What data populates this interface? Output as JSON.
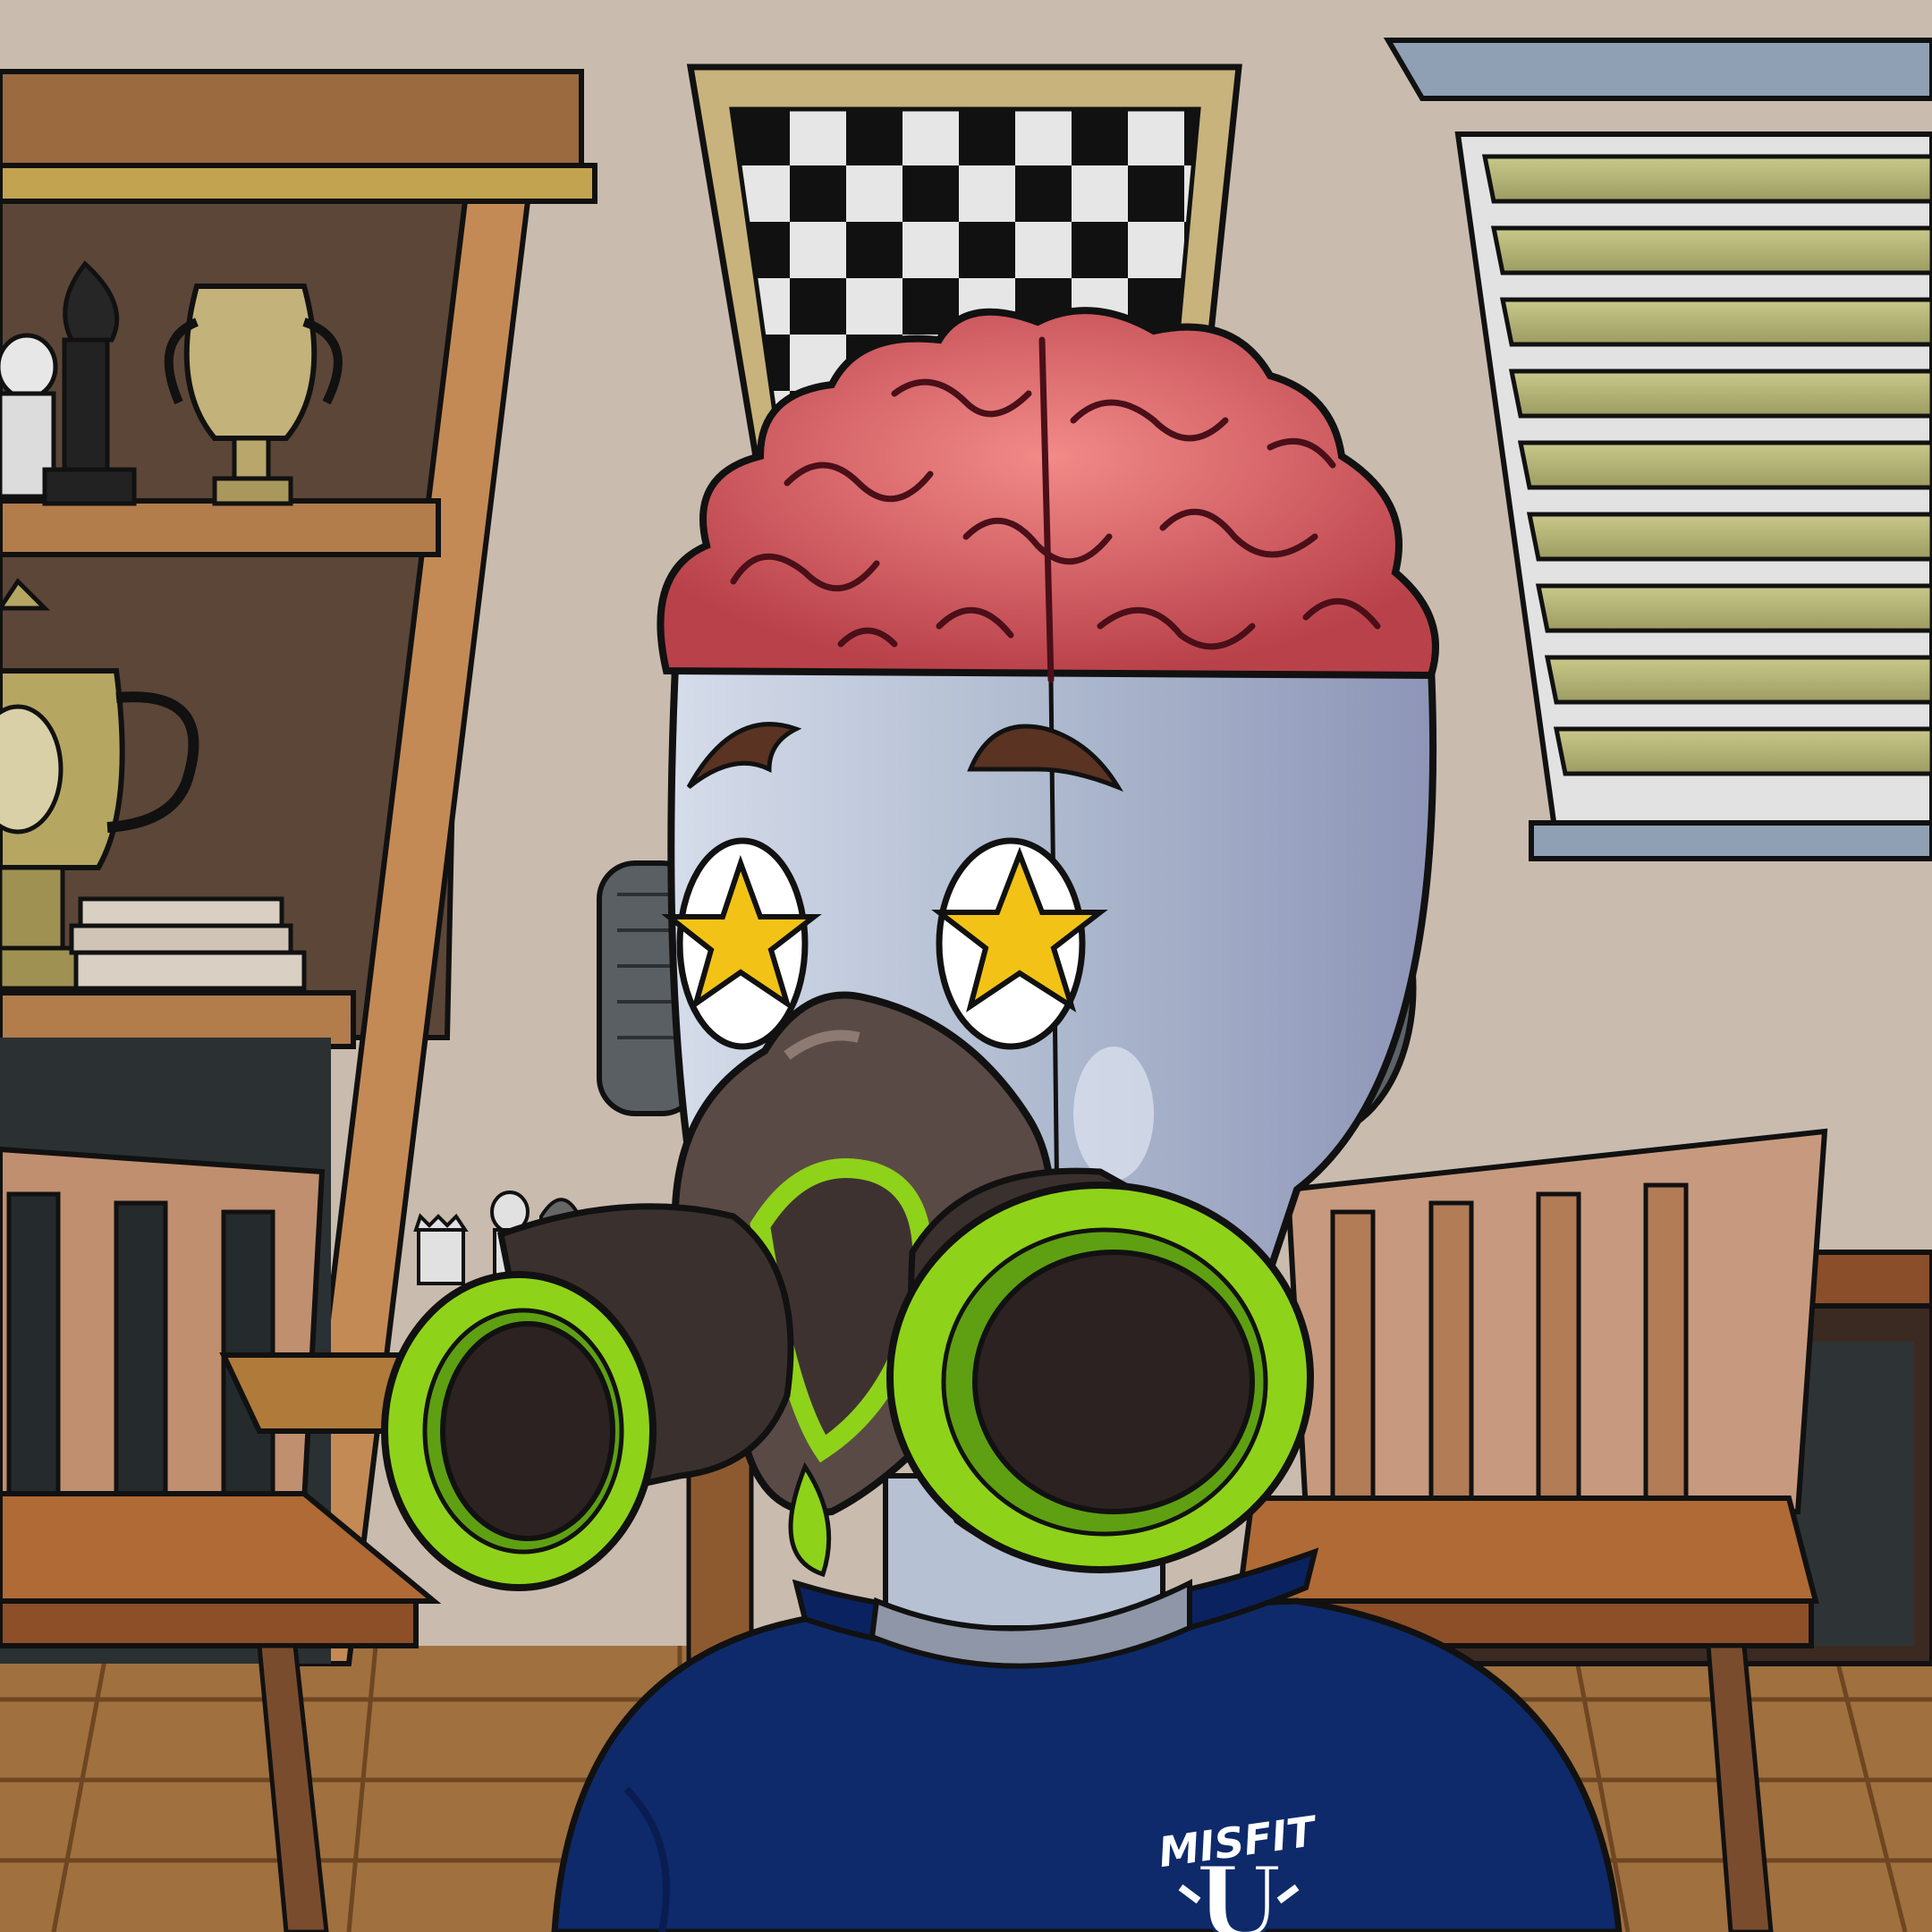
{
  "artwork": {
    "type": "cartoon character avatar illustration",
    "palette": {
      "wall": "#c9bcae",
      "floor": "#9c6a3e",
      "shelf_wood": "#a8743f",
      "brain_pink": "#e96a6e",
      "brain_dark": "#9a2e36",
      "skin_silver": "#b8c3d6",
      "mask_brown": "#5a4a45",
      "filter_green": "#8fd21a",
      "sweater_navy": "#0e2a6b",
      "star_yellow": "#f2c316",
      "blinds_green": "#b8b878",
      "outline": "#111111"
    }
  },
  "sweater": {
    "logo_line1": "MISFIT",
    "logo_line2": "U"
  }
}
